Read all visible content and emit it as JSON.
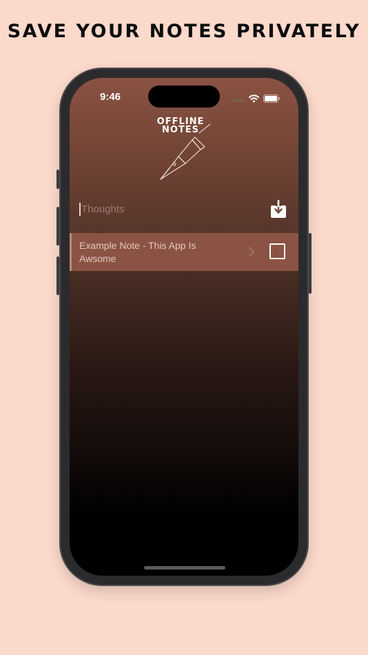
{
  "headline": "SAVE YOUR NOTES PRIVATELY",
  "status_bar": {
    "time": "9:46",
    "signal_icon": "signal-dots-icon",
    "wifi_icon": "wifi-icon",
    "battery_icon": "battery-icon"
  },
  "app": {
    "logo_line1": "OFFLINE",
    "logo_line2": "NOTES",
    "logo_icon": "fountain-pen-icon",
    "input": {
      "placeholder": "Thoughts",
      "value": ""
    },
    "save_icon": "save-download-icon",
    "notes": [
      {
        "text": "Example Note - This App Is Awsome",
        "chevron_icon": "chevron-right-icon",
        "checked": false
      }
    ]
  },
  "colors": {
    "background": "#fbd9cb",
    "note_row": "#8b5343",
    "gradient_top": "#8a5243",
    "gradient_bottom": "#000000"
  }
}
